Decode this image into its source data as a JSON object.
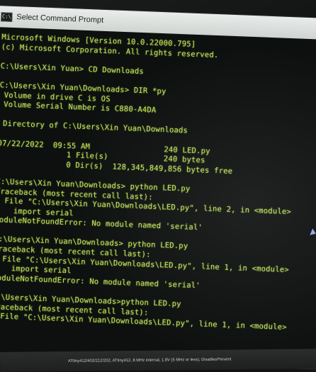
{
  "window": {
    "title": "Select Command Prompt",
    "icon": "cmd-icon",
    "icon_glyph": "C:\\"
  },
  "console": {
    "text_color": "#bfe05a",
    "background": "#0d100e",
    "lines": [
      "Microsoft Windows [Version 10.0.22000.795]",
      "(c) Microsoft Corporation. All rights reserved.",
      "",
      "C:\\Users\\Xin Yuan> CD Downloads",
      "",
      "C:\\Users\\Xin Yuan\\Downloads> DIR *py",
      " Volume in drive C is OS",
      " Volume Serial Number is C880-A4DA",
      "",
      " Directory of C:\\Users\\Xin Yuan\\Downloads",
      "",
      "07/22/2022  09:55 AM                240 LED.py",
      "               1 File(s)            240 bytes",
      "               0 Dir(s)  128,345,849,856 bytes free",
      "",
      "C:\\Users\\Xin Yuan\\Downloads> python LED.py",
      "Traceback (most recent call last):",
      "  File \"C:\\Users\\Xin Yuan\\Downloads\\LED.py\", line 2, in <module>",
      "    import serial",
      "ModuleNotFoundError: No module named 'serial'",
      "",
      "C:\\Users\\Xin Yuan\\Downloads> python LED.py",
      "Traceback (most recent call last):",
      "  File \"C:\\Users\\Xin Yuan\\Downloads\\LED.py\", line 1, in <module>",
      "    import serial",
      "ModuleNotFoundError: No module named 'serial'",
      "",
      "C:\\Users\\Xin Yuan\\Downloads>python LED.py",
      "Traceback (most recent call last):",
      "  File \"C:\\Users\\Xin Yuan\\Downloads\\LED.py\", line 1, in <module>"
    ]
  },
  "taskbar": {
    "status_text": "ATtiny412/402/212/202, ATtiny412, 8 MHz internal, 1.8V (5 MHz or less), DisablesPrevent"
  }
}
